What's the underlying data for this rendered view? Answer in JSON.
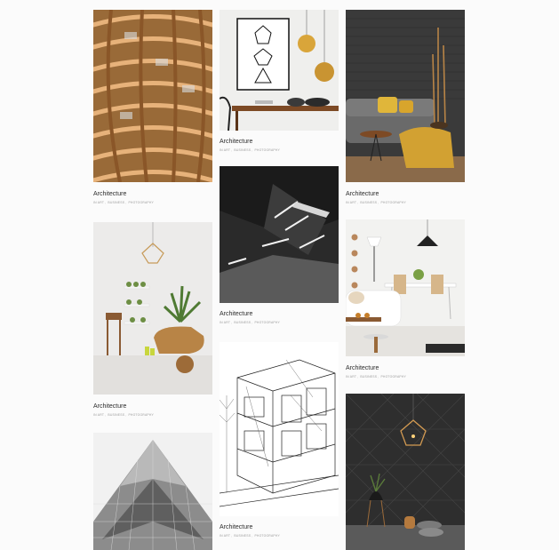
{
  "gallery": {
    "columns": [
      [
        {
          "title": "Architecture",
          "prefix": "in",
          "categories": [
            "art",
            "business",
            "photography"
          ],
          "image": "wooden-ceiling-lattice"
        },
        {
          "title": "Architecture",
          "prefix": "in",
          "categories": [
            "art",
            "business",
            "photography"
          ],
          "image": "interior-plants-wooden-bench"
        },
        {
          "title": "",
          "prefix": "",
          "categories": [],
          "image": "triangular-glass-facade"
        }
      ],
      [
        {
          "title": "Architecture",
          "prefix": "in",
          "categories": [
            "art",
            "business",
            "photography"
          ],
          "image": "geometric-poster-gold-lamps"
        },
        {
          "title": "Architecture",
          "prefix": "in",
          "categories": [
            "art",
            "business",
            "photography"
          ],
          "image": "abstract-dark-angular-space"
        },
        {
          "title": "Architecture",
          "prefix": "in",
          "categories": [
            "art",
            "business",
            "photography"
          ],
          "image": "wireframe-building-sketch"
        }
      ],
      [
        {
          "title": "Architecture",
          "prefix": "in",
          "categories": [
            "art",
            "business",
            "photography"
          ],
          "image": "grey-sofa-brick-wall"
        },
        {
          "title": "Architecture",
          "prefix": "in",
          "categories": [
            "art",
            "business",
            "photography"
          ],
          "image": "white-dining-room"
        },
        {
          "title": "",
          "prefix": "",
          "categories": [],
          "image": "dark-geometric-wall-lamp"
        }
      ]
    ],
    "colors": {
      "background": "#fbfbfb",
      "title": "#2b2b2b",
      "meta": "#9a9a9a"
    }
  }
}
